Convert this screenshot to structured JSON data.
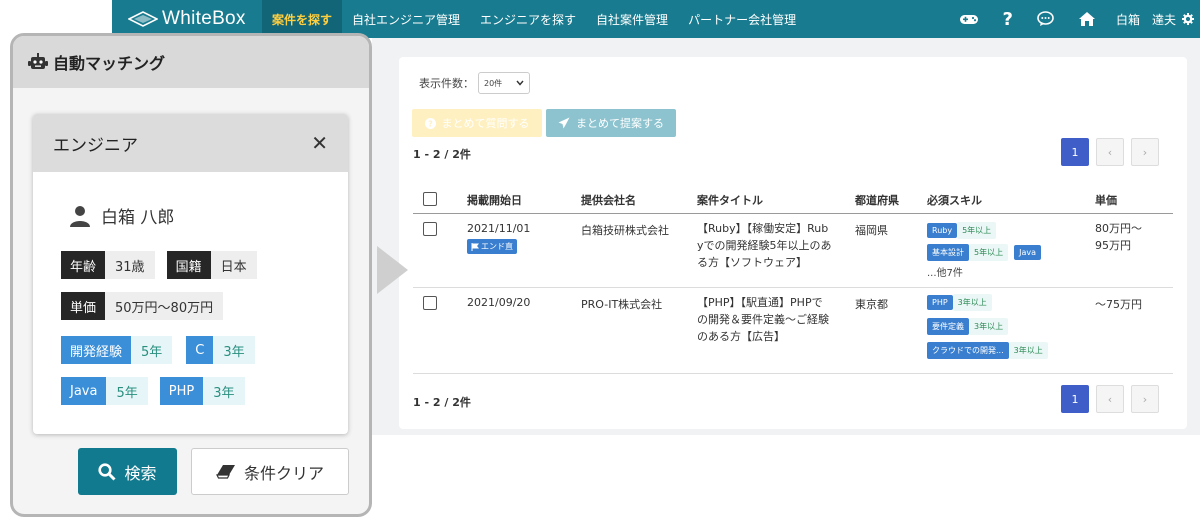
{
  "nav": {
    "brand": "WhiteBox",
    "items": [
      "案件を探す",
      "自社エンジニア管理",
      "エンジニアを探す",
      "自社案件管理",
      "パートナー会社管理"
    ],
    "active_index": 0,
    "user_name": "白箱　達夫",
    "icons": [
      "gamepad-icon",
      "help-icon",
      "chat-icon",
      "home-icon",
      "gear-icon"
    ]
  },
  "list": {
    "page_size_label": "表示件数：",
    "page_size_value": "20件",
    "btn_ask": "まとめて質問する",
    "btn_propose": "まとめて提案する",
    "count": "1 - 2 / 2件",
    "pager": {
      "prev": "‹",
      "current": "1",
      "next": "›"
    },
    "columns": [
      "掲載開始日",
      "提供会社名",
      "案件タイトル",
      "都道府県",
      "必須スキル",
      "単価"
    ],
    "rows": [
      {
        "date": "2021/11/01",
        "badge": "エンド直",
        "company": "白箱技研株式会社",
        "title_lines": [
          "【Ruby】【稼働安定】Rub",
          "yでの開発経験5年以上のあ",
          "る方【ソフトウェア】"
        ],
        "pref": "福岡県",
        "skills": [
          {
            "name": "Ruby",
            "years": "5年以上"
          },
          {
            "name": "基本設計",
            "years": "5年以上"
          },
          {
            "name": "Java",
            "years": ""
          }
        ],
        "more": "...他7件",
        "price_lines": [
          "80万円～",
          "95万円"
        ]
      },
      {
        "date": "2021/09/20",
        "badge": "",
        "company": "PRO-IT株式会社",
        "title_lines": [
          "【PHP】【駅直通】PHPで",
          "の開発＆要件定義～ご経験",
          "のある方【広告】"
        ],
        "pref": "東京都",
        "skills": [
          {
            "name": "PHP",
            "years": "3年以上"
          },
          {
            "name": "要件定義",
            "years": "3年以上"
          },
          {
            "name": "クラウドでの開発...",
            "years": "3年以上"
          }
        ],
        "more": "",
        "price_lines": [
          "～75万円"
        ]
      }
    ]
  },
  "panel": {
    "title": "自動マッチング",
    "inner_title": "エンジニア",
    "close_glyph": "✕",
    "person_name": "白箱 八郎",
    "age_label": "年齢",
    "age_value": "31歳",
    "nationality_label": "国籍",
    "nationality_value": "日本",
    "price_label": "単価",
    "price_value": "50万円～80万円",
    "skills": [
      {
        "name": "開発経験",
        "years": "5年"
      },
      {
        "name": "C",
        "years": "3年"
      },
      {
        "name": "Java",
        "years": "5年"
      },
      {
        "name": "PHP",
        "years": "3年"
      }
    ],
    "search_button": "検索",
    "clear_button": "条件クリア"
  },
  "colors": {
    "nav_bg": "#197b8f",
    "nav_active_text": "#ffcf40",
    "pager_active": "#3f5ec7",
    "skill_blue": "#3a7fcf",
    "search_button": "#127a8f"
  }
}
